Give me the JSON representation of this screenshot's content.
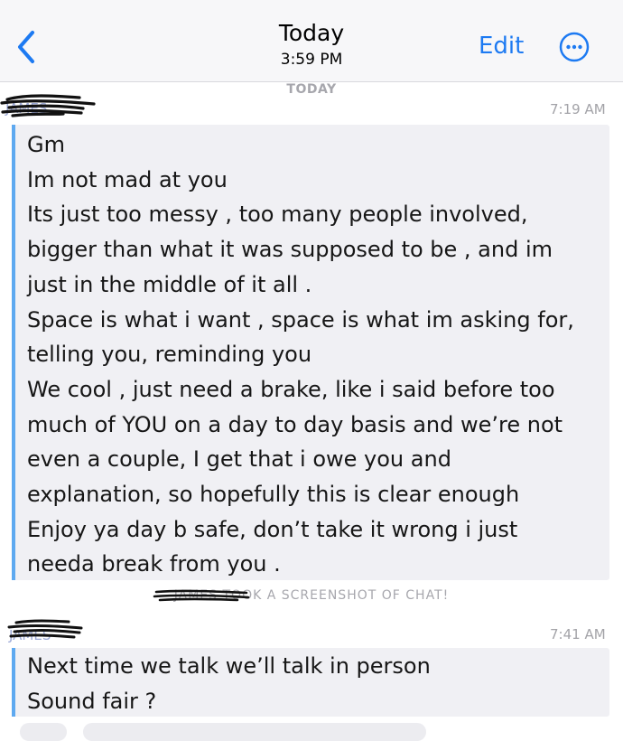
{
  "header": {
    "title": "Today",
    "subtitle": "3:59 PM",
    "edit_label": "Edit",
    "back_icon": "chevron-left-icon",
    "more_icon": "ellipsis-circle-icon",
    "accent_color": "#1d7af2"
  },
  "day_separator": "TODAY",
  "messages": [
    {
      "sender": "JAMES",
      "time": "7:19 AM",
      "lines": [
        "Gm",
        "Im not mad at you",
        "Its just too messy , too many people involved,",
        "bigger than what it was supposed to be , and im",
        "just in the middle of it all .",
        "Space is what i want , space is what im asking for,",
        "telling you, reminding you",
        "We cool , just need a brake, like i said before too",
        "much of YOU on a day to day basis and we’re not",
        "even a couple, I get that i owe you and",
        "explanation, so hopefully this is clear enough",
        "Enjoy ya day b safe, don’t take it wrong i just",
        "needa break from you ."
      ]
    },
    {
      "sender": "JAMES",
      "time": "7:41 AM",
      "lines": [
        "Next time we talk we’ll talk in person",
        "Sound fair ?"
      ]
    }
  ],
  "system_note": {
    "name": "JAMES",
    "text": "TOOK A SCREENSHOT OF CHAT!"
  },
  "colors": {
    "bubble": "#f0f0f4",
    "bar": "#5ea9f0",
    "meta_text": "#a3a3a8"
  }
}
